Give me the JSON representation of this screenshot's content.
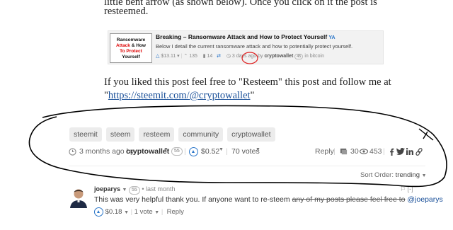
{
  "article": {
    "line1": "little bent arrow (as shown below). Once you click on it the post is",
    "line2": "resteemed.",
    "line3": "If you liked this post feel free to \"Resteem\" this post and follow me at",
    "line4_prefix": "\"",
    "line4_link": "https://steemit.com/@cryptowallet",
    "line4_suffix": "\""
  },
  "embed": {
    "thumb_l1": "Ransomware",
    "thumb_l2_red": "Attack",
    "thumb_l2_rest": " & How",
    "thumb_l3": "To Protect",
    "thumb_l4": "Yourself",
    "title": "Breaking – Ransomware Attack and How to Protect Yourself",
    "title_badge": "YA",
    "desc": "Below I detail the current ransomware attack and how to potentially protect yourself.",
    "payout": "$13.11",
    "votes": "135",
    "comments": "14",
    "time": "3 days ago by",
    "author": "cryptowallet",
    "rep": "45",
    "category": "in bitcoin"
  },
  "tags": [
    "steemit",
    "steem",
    "resteem",
    "community",
    "cryptowallet"
  ],
  "post_meta": {
    "time": "3 months ago by",
    "author": "cryptowallet",
    "rep": "55",
    "payout": "$0.52",
    "votes": "70 votes",
    "reply": "Reply",
    "comments": "30",
    "views": "453"
  },
  "sort": {
    "label": "Sort Order:",
    "value": "trending"
  },
  "comment": {
    "author": "joeparys",
    "rep": "55",
    "time": "last month",
    "body_plain": "This was very helpful thank you. If anyone want to re-steem ",
    "body_strike": "any of my posts please feel free to",
    "body_mention": " @joeparys",
    "payout": "$0.18",
    "votes": "1 vote",
    "reply": "Reply",
    "collapse": "[-]"
  },
  "colors": {
    "link": "#1a5099",
    "upvote": "#2a76c9",
    "scribble": "#000000",
    "red_circle": "#e02020"
  }
}
